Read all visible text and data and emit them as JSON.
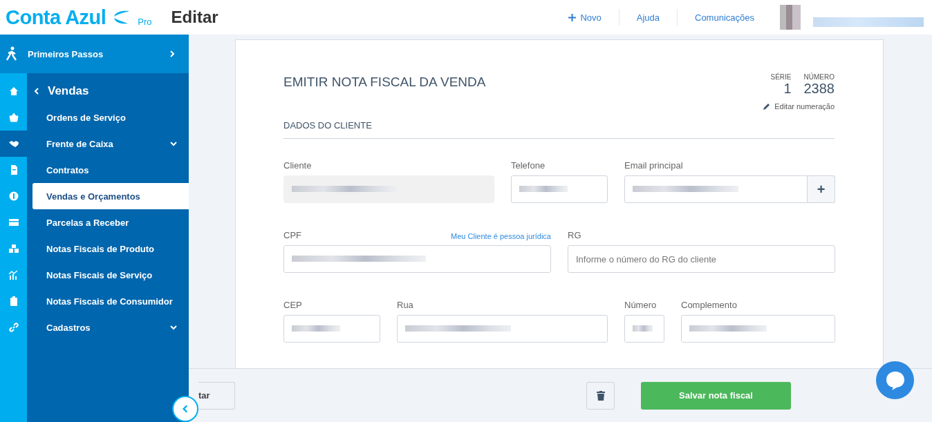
{
  "header": {
    "logo": "Conta Azul",
    "logo_badge": "Pro",
    "page_title": "Editar",
    "links": [
      {
        "label": "Novo",
        "kind": "new"
      },
      {
        "label": "Ajuda",
        "kind": "plain"
      },
      {
        "label": "Comunicações",
        "kind": "plain"
      }
    ]
  },
  "sidebar": {
    "top_item": {
      "label": "Primeiros Passos"
    },
    "section": {
      "label": "Vendas"
    },
    "rail_items": [
      {
        "selected": false
      },
      {
        "selected": false
      },
      {
        "selected": true
      },
      {
        "selected": false
      },
      {
        "selected": false
      },
      {
        "selected": false
      },
      {
        "selected": false
      },
      {
        "selected": false
      },
      {
        "selected": false
      },
      {
        "selected": false
      }
    ],
    "items": [
      {
        "label": "Ordens de Serviço",
        "selected": false,
        "has_submenu": false
      },
      {
        "label": "Frente de Caixa",
        "selected": false,
        "has_submenu": true
      },
      {
        "label": "Contratos",
        "selected": false,
        "has_submenu": false
      },
      {
        "label": "Vendas e Orçamentos",
        "selected": true,
        "has_submenu": false
      },
      {
        "label": "Parcelas a Receber",
        "selected": false,
        "has_submenu": false
      },
      {
        "label": "Notas Fiscais de Produto",
        "selected": false,
        "has_submenu": false
      },
      {
        "label": "Notas Fiscais de Serviço",
        "selected": false,
        "has_submenu": false
      },
      {
        "label": "Notas Fiscais de Consumidor",
        "selected": false,
        "has_submenu": false
      },
      {
        "label": "Cadastros",
        "selected": false,
        "has_submenu": true
      }
    ]
  },
  "form": {
    "title": "EMITIR NOTA FISCAL DA VENDA",
    "serie_label": "SÉRIE",
    "serie": "1",
    "numero_label": "NÚMERO",
    "numero": "2388",
    "edit_numbering": "Editar numeração",
    "section": "DADOS DO CLIENTE",
    "client_fields": [
      {
        "label": "Cliente",
        "disabled": true,
        "value_redacted": true
      },
      {
        "label": "Telefone",
        "disabled": false,
        "value_redacted": true
      },
      {
        "label": "Email principal",
        "disabled": false,
        "value_redacted": true,
        "add_button": "+"
      }
    ],
    "document_fields": [
      {
        "label": "CPF",
        "disabled": false,
        "value_redacted": true,
        "link": "Meu Cliente é pessoa jurídica"
      },
      {
        "label": "RG",
        "disabled": false,
        "value_redacted": false,
        "placeholder": "Informe o número do RG do cliente"
      }
    ],
    "address_fields": [
      {
        "label": "CEP",
        "disabled": false,
        "value_redacted": true
      },
      {
        "label": "Rua",
        "disabled": false,
        "value_redacted": true
      },
      {
        "label": "Número",
        "disabled": false,
        "value_redacted": true
      },
      {
        "label": "Complemento",
        "disabled": false,
        "value_redacted": true
      }
    ]
  },
  "footer": {
    "cut_button": "tar",
    "save_button": "Salvar nota fiscal"
  }
}
